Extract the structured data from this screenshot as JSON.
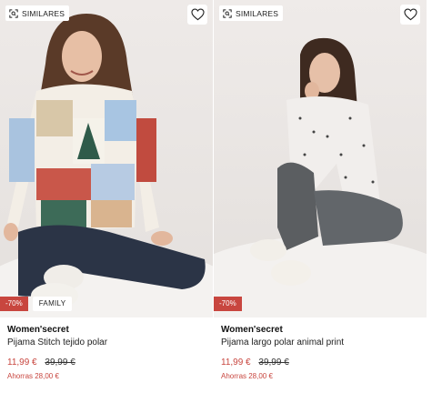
{
  "products": [
    {
      "similar_label": "SIMILARES",
      "discount_badge": "-70%",
      "tag_badge": "FAMILY",
      "brand": "Women'secret",
      "name": "Pijama Stitch tejido polar",
      "price_current": "11,99 €",
      "price_original": "39,99 €",
      "savings": "Ahorras 28,00 €",
      "image_description_icon": "model-christmas-sweater-photo"
    },
    {
      "similar_label": "SIMILARES",
      "discount_badge": "-70%",
      "brand": "Women'secret",
      "name": "Pijama largo polar animal print",
      "price_current": "11,99 €",
      "price_original": "39,99 €",
      "savings": "Ahorras 28,00 €",
      "image_description_icon": "model-animal-print-pajama-photo"
    }
  ],
  "colors": {
    "accent_red": "#c8463f",
    "text": "#111111",
    "photo_bg": "#ece8e5"
  },
  "icons": {
    "similar": "scan-similar-icon",
    "favorite": "heart-outline-icon"
  }
}
